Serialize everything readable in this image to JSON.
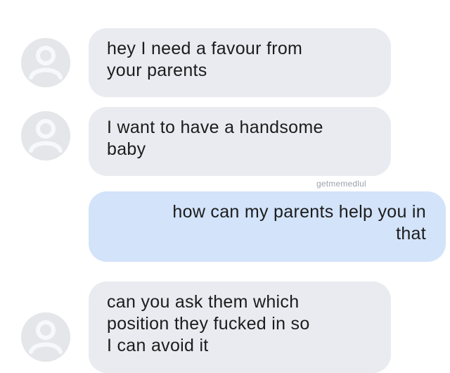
{
  "colors": {
    "incoming_bubble": "#e9ebf0",
    "outgoing_bubble": "#d2e3fa",
    "avatar_bg": "#e4e6ea",
    "text": "#1c1c1c"
  },
  "avatar_icon": "person-icon",
  "messages": [
    {
      "direction": "incoming",
      "lines": [
        "hey I need a favour from",
        "your parents"
      ]
    },
    {
      "direction": "incoming",
      "lines": [
        "I want to have a handsome",
        "baby"
      ]
    },
    {
      "direction": "outgoing",
      "lines": [
        "how can my parents help you in",
        "that"
      ]
    },
    {
      "direction": "incoming",
      "lines": [
        "can you ask them which",
        "position they fucked in so",
        "I can avoid it"
      ]
    }
  ],
  "watermark": "getmemedlul"
}
